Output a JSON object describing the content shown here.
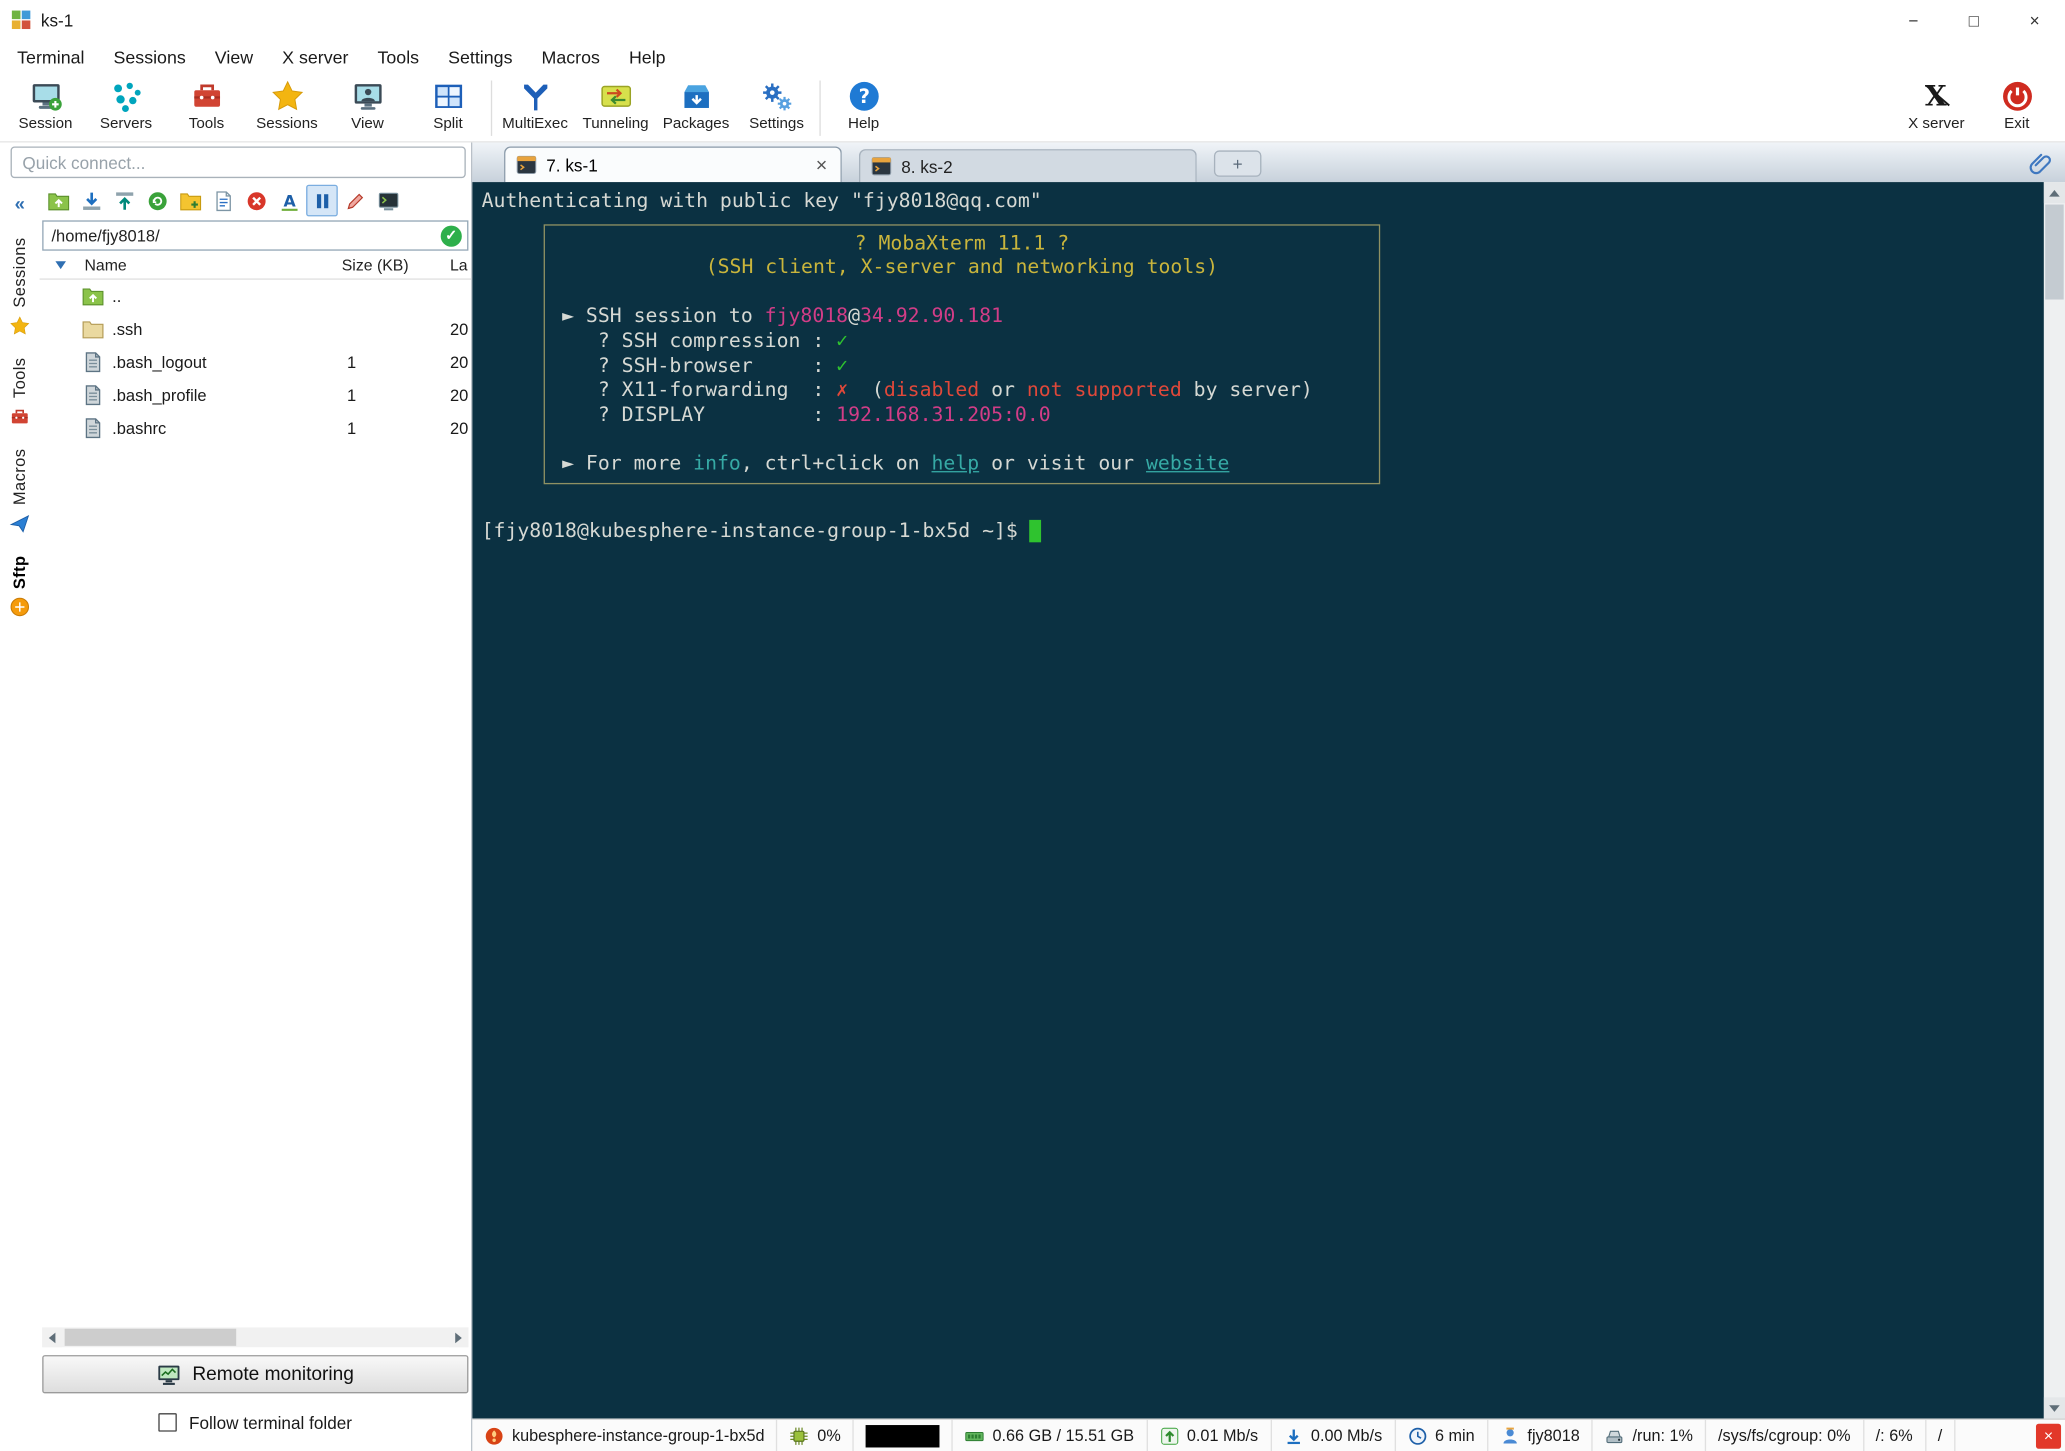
{
  "window": {
    "title": "ks-1",
    "minimize_glyph": "−",
    "maximize_glyph": "□",
    "close_glyph": "×"
  },
  "menubar": [
    "Terminal",
    "Sessions",
    "View",
    "X server",
    "Tools",
    "Settings",
    "Macros",
    "Help"
  ],
  "toolbar": {
    "left": [
      {
        "label": "Session",
        "icon": "session-icon"
      },
      {
        "label": "Servers",
        "icon": "servers-icon"
      },
      {
        "label": "Tools",
        "icon": "tools-icon"
      },
      {
        "label": "Sessions",
        "icon": "sessions-star-icon"
      },
      {
        "label": "View",
        "icon": "view-icon"
      },
      {
        "label": "Split",
        "icon": "split-icon",
        "divider_after": true
      },
      {
        "label": "MultiExec",
        "icon": "multiexec-icon"
      },
      {
        "label": "Tunneling",
        "icon": "tunneling-icon"
      },
      {
        "label": "Packages",
        "icon": "packages-icon"
      },
      {
        "label": "Settings",
        "icon": "settings-icon",
        "divider_after": true
      },
      {
        "label": "Help",
        "icon": "help-icon"
      }
    ],
    "right": [
      {
        "label": "X server",
        "icon": "xserver-icon"
      },
      {
        "label": "Exit",
        "icon": "exit-icon"
      }
    ]
  },
  "quick_connect_placeholder": "Quick connect...",
  "sidebar_collapse_glyph": "«",
  "side_tabs": [
    {
      "label": "Sessions",
      "icon": "star-icon",
      "active": false
    },
    {
      "label": "Tools",
      "icon": "toolbox-icon",
      "active": false
    },
    {
      "label": "Macros",
      "icon": "macros-icon",
      "active": false
    },
    {
      "label": "Sftp",
      "icon": "sftp-icon",
      "active": true
    }
  ],
  "file_panel": {
    "toolbar_icons": [
      {
        "name": "folder-up-icon"
      },
      {
        "name": "download-icon"
      },
      {
        "name": "upload-icon"
      },
      {
        "name": "refresh-icon"
      },
      {
        "name": "new-folder-icon"
      },
      {
        "name": "new-file-icon"
      },
      {
        "name": "delete-icon"
      },
      {
        "name": "encoding-icon"
      },
      {
        "name": "pause-icon",
        "selected": true
      },
      {
        "name": "edit-icon"
      },
      {
        "name": "terminal-sync-icon"
      }
    ],
    "path": "/home/fjy8018/",
    "path_ok_glyph": "✓",
    "columns": [
      "Name",
      "Size (KB)",
      "La"
    ],
    "rows": [
      {
        "icon": "folder-up-icon",
        "name": "..",
        "size": "",
        "date": ""
      },
      {
        "icon": "folder-icon",
        "name": ".ssh",
        "size": "",
        "date": "20"
      },
      {
        "icon": "file-icon",
        "name": ".bash_logout",
        "size": "1",
        "date": "20"
      },
      {
        "icon": "file-icon",
        "name": ".bash_profile",
        "size": "1",
        "date": "20"
      },
      {
        "icon": "file-icon",
        "name": ".bashrc",
        "size": "1",
        "date": "20"
      }
    ],
    "remote_monitoring_label": "Remote monitoring",
    "follow_label": "Follow terminal folder"
  },
  "tab_bar": {
    "tabs": [
      {
        "label": "7. ks-1",
        "active": true
      },
      {
        "label": "8. ks-2",
        "active": false
      }
    ],
    "close_glyph": "×",
    "new_tab_label": "+"
  },
  "terminal": {
    "colors": {
      "background": "#0b3142",
      "foreground": "#d6d9d4",
      "yellow": "#c9b53c",
      "magenta": "#d23d87",
      "green": "#2fc32f",
      "red": "#e0483a",
      "cyan": "#36aaa5",
      "cursor": "#2fc32f"
    },
    "auth_line": [
      {
        "t": "Authenticating with public key \"fjy8018@qq.com\"",
        "c": "fg"
      }
    ],
    "banner": {
      "lines": [
        {
          "center": true,
          "seg": [
            {
              "t": "? MobaXterm 11.1 ?",
              "c": "yellow"
            }
          ]
        },
        {
          "center": true,
          "seg": [
            {
              "t": "(SSH client, X-server and networking tools)",
              "c": "yellow"
            }
          ]
        },
        {
          "seg": [
            {
              "t": "",
              "c": "fg"
            }
          ]
        },
        {
          "seg": [
            {
              "t": "► SSH session to ",
              "c": "fg"
            },
            {
              "t": "fjy8018",
              "c": "magenta"
            },
            {
              "t": "@",
              "c": "fg"
            },
            {
              "t": "34.92.90.181",
              "c": "magenta"
            }
          ]
        },
        {
          "seg": [
            {
              "t": "   ? SSH compression : ",
              "c": "fg"
            },
            {
              "t": "✓",
              "c": "green"
            }
          ]
        },
        {
          "seg": [
            {
              "t": "   ? SSH-browser     : ",
              "c": "fg"
            },
            {
              "t": "✓",
              "c": "green"
            }
          ]
        },
        {
          "seg": [
            {
              "t": "   ? X11-forwarding  : ",
              "c": "fg"
            },
            {
              "t": "✗",
              "c": "red"
            },
            {
              "t": "  (",
              "c": "fg"
            },
            {
              "t": "disabled",
              "c": "red"
            },
            {
              "t": " or ",
              "c": "fg"
            },
            {
              "t": "not supported",
              "c": "red"
            },
            {
              "t": " by server)",
              "c": "fg"
            }
          ]
        },
        {
          "seg": [
            {
              "t": "   ? DISPLAY         : ",
              "c": "fg"
            },
            {
              "t": "192.168.31.205:0.0",
              "c": "magenta"
            }
          ]
        },
        {
          "seg": [
            {
              "t": "",
              "c": "fg"
            }
          ]
        },
        {
          "seg": [
            {
              "t": "► For more ",
              "c": "fg"
            },
            {
              "t": "info",
              "c": "cyan"
            },
            {
              "t": ", ctrl+click on ",
              "c": "fg"
            },
            {
              "t": "help",
              "c": "link"
            },
            {
              "t": " or visit our ",
              "c": "fg"
            },
            {
              "t": "website",
              "c": "link"
            }
          ]
        }
      ]
    },
    "prompt": [
      {
        "t": "[fjy8018@kubesphere-instance-group-1-bx5d ~]$ ",
        "c": "fg"
      }
    ]
  },
  "statusbar": {
    "segments": [
      {
        "icon": "moba-logo-icon",
        "text": "kubesphere-instance-group-1-bx5d"
      },
      {
        "icon": "cpu-icon",
        "text": "0%"
      },
      {
        "icon": "graph-box",
        "text": ""
      },
      {
        "icon": "ram-icon",
        "text": "0.66 GB / 15.51 GB"
      },
      {
        "icon": "net-up-icon",
        "text": "0.01 Mb/s"
      },
      {
        "icon": "net-down-icon",
        "text": "0.00 Mb/s"
      },
      {
        "icon": "uptime-icon",
        "text": "6 min"
      },
      {
        "icon": "user-icon",
        "text": "fjy8018"
      },
      {
        "icon": "disk-icon",
        "text": "/run: 1%"
      },
      {
        "icon": null,
        "text": "/sys/fs/cgroup: 0%"
      },
      {
        "icon": null,
        "text": "/: 6%"
      },
      {
        "icon": null,
        "text": "/"
      }
    ],
    "close_glyph": "×"
  }
}
